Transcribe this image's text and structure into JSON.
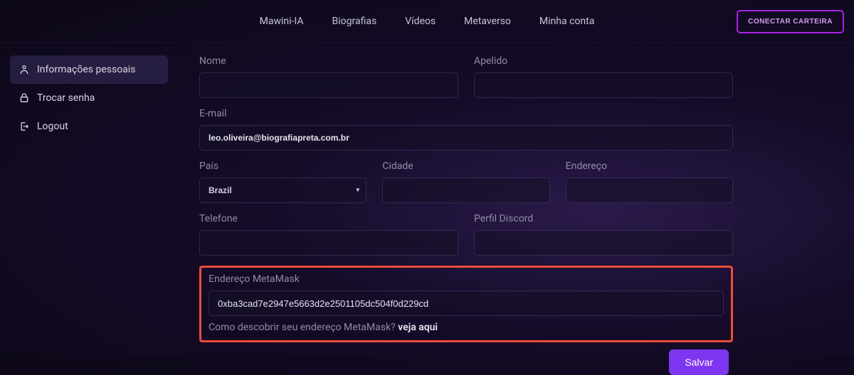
{
  "nav": {
    "items": [
      {
        "label": "Mawini-IA"
      },
      {
        "label": "Biografias"
      },
      {
        "label": "Vídeos"
      },
      {
        "label": "Metaverso"
      },
      {
        "label": "Minha conta"
      }
    ],
    "connect_label": "CONECTAR CARTEIRA"
  },
  "sidebar": {
    "items": [
      {
        "label": "Informações pessoais"
      },
      {
        "label": "Trocar senha"
      },
      {
        "label": "Logout"
      }
    ]
  },
  "form": {
    "name_label": "Nome",
    "name_value": "",
    "nickname_label": "Apelido",
    "nickname_value": "",
    "email_label": "E-mail",
    "email_value": "leo.oliveira@biografiapreta.com.br",
    "country_label": "País",
    "country_value": "Brazil",
    "city_label": "Cidade",
    "city_value": "",
    "address_label": "Endereço",
    "address_value": "",
    "phone_label": "Telefone",
    "phone_value": "",
    "discord_label": "Perfil Discord",
    "discord_value": "",
    "metamask_label": "Endereço MetaMask",
    "metamask_value": "0xba3cad7e2947e5663d2e2501105dc504f0d229cd",
    "metamask_help_prefix": "Como descobrir seu endereço MetaMask? ",
    "metamask_help_link": "veja aqui",
    "save_label": "Salvar"
  }
}
